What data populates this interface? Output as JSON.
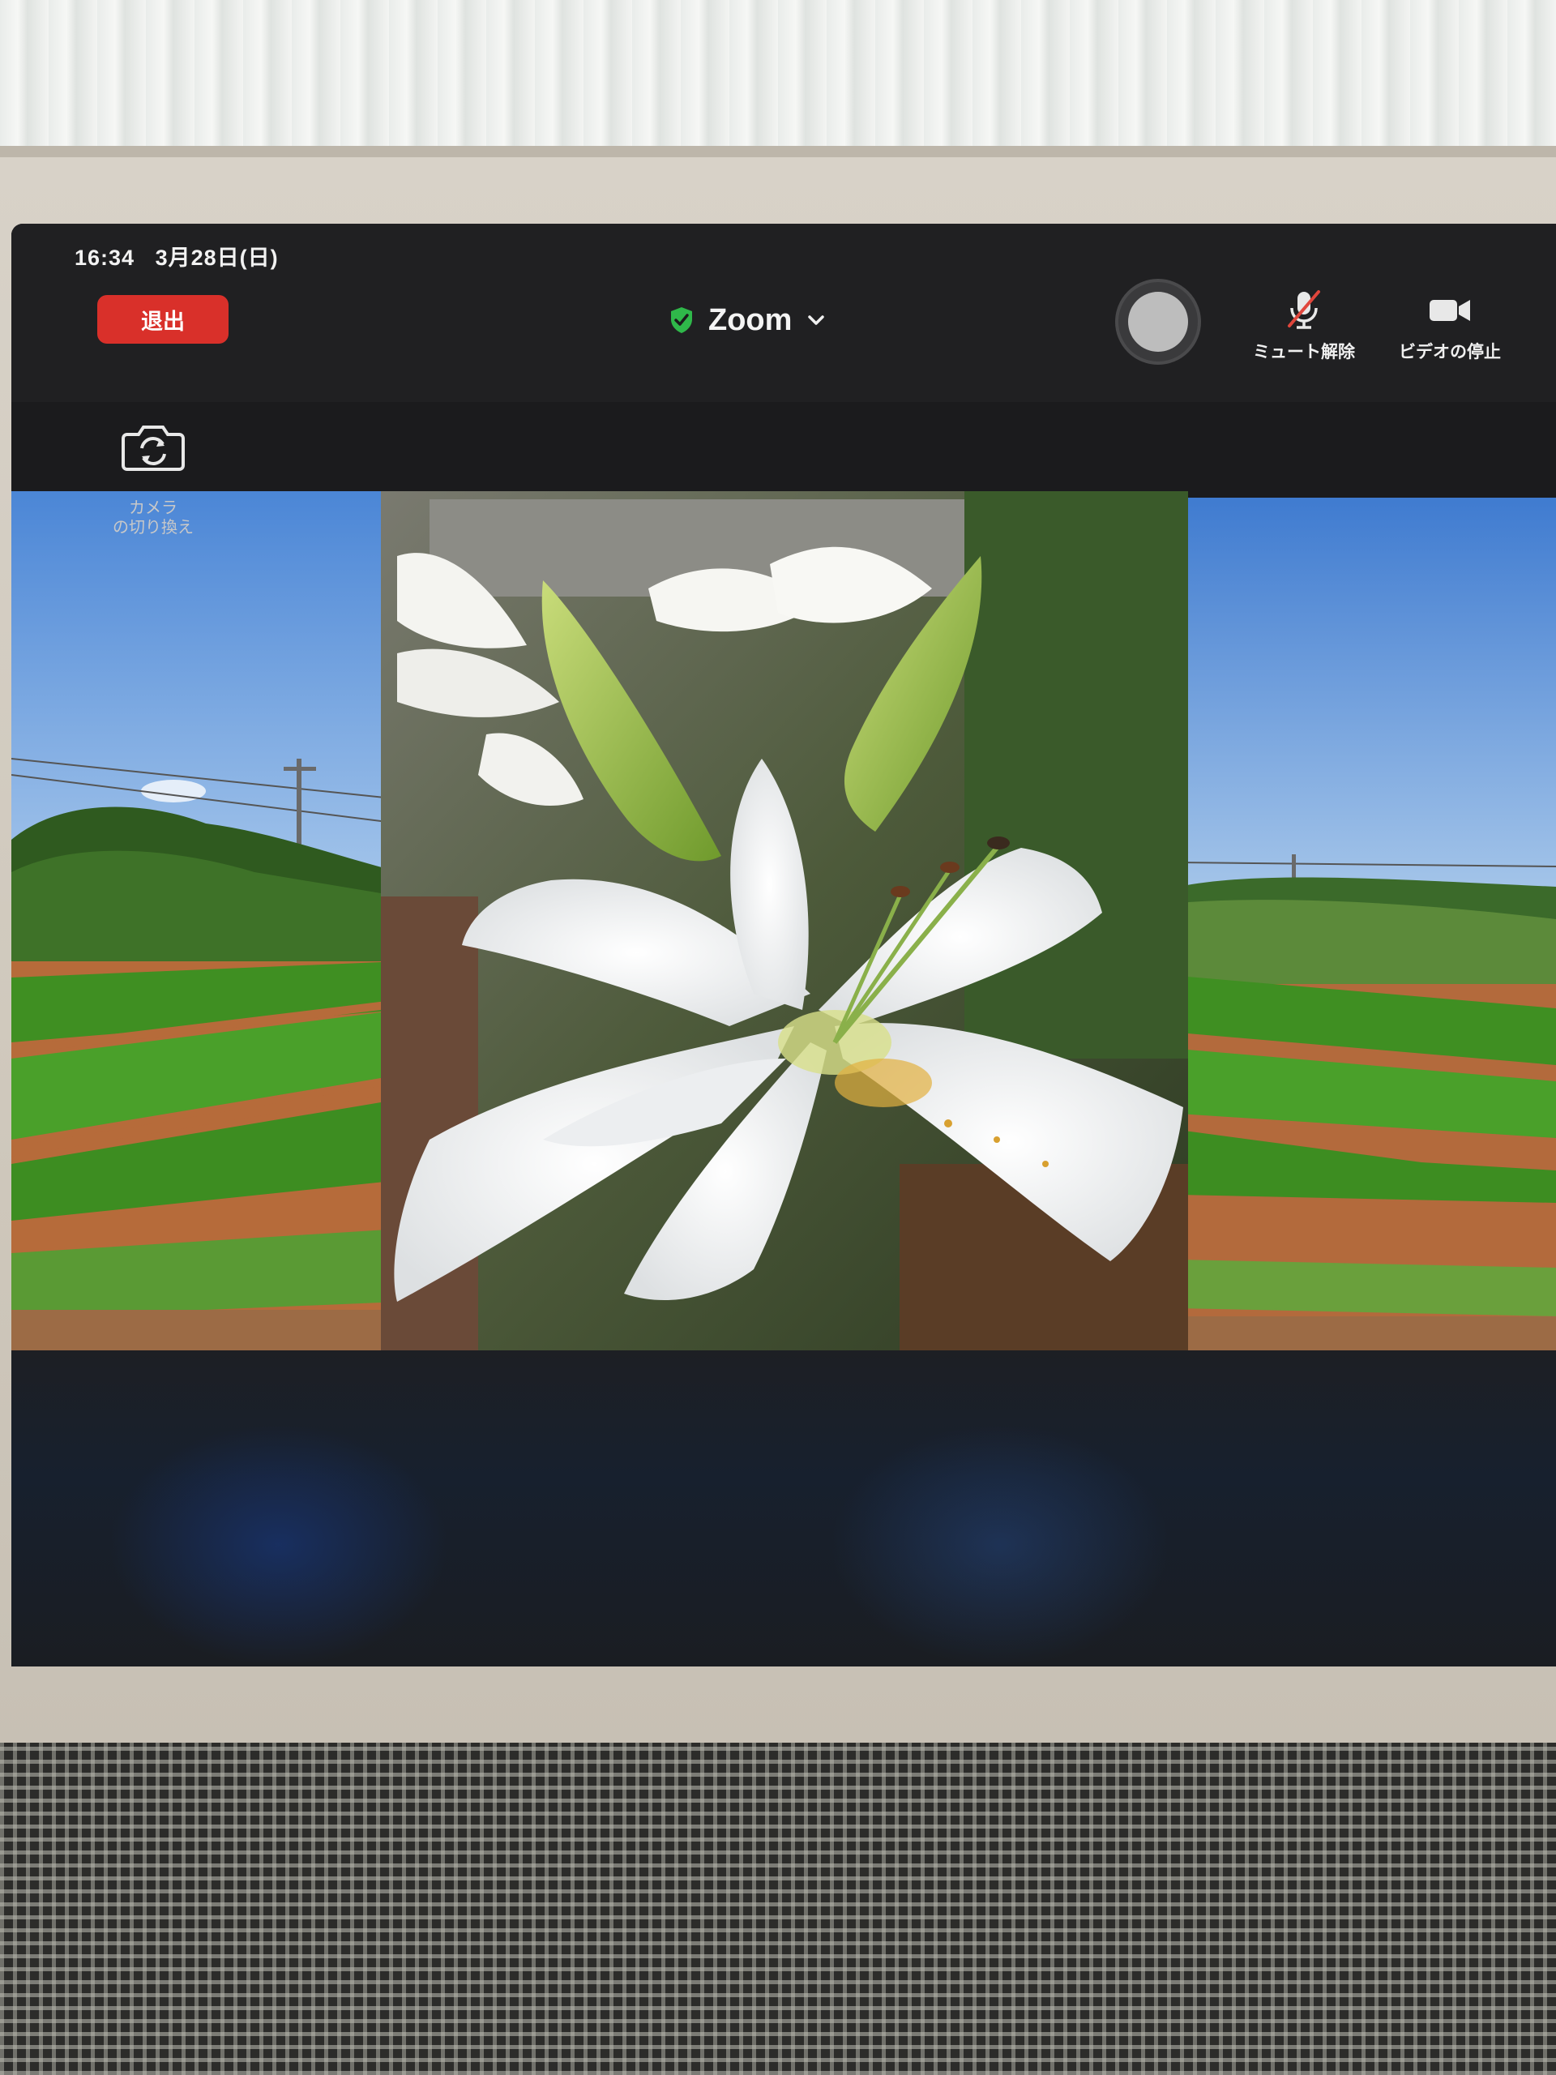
{
  "status_bar": {
    "time": "16:34",
    "date": "3月28日(日)"
  },
  "toolbar": {
    "leave_label": "退出",
    "meeting_name": "Zoom",
    "unmute_label": "ミュート解除",
    "stop_video_label": "ビデオの停止"
  },
  "camera": {
    "switch_label_line1": "カメラ",
    "switch_label_line2": "の切り換え"
  },
  "icons": {
    "shield": "shield-check-icon",
    "chevron": "chevron-down-icon",
    "mic": "mic-muted-icon",
    "video": "video-camera-icon",
    "camera_switch": "camera-switch-icon"
  },
  "colors": {
    "leave": "#d9302a",
    "shield": "#2fb84a",
    "mute_slash": "#e0463c"
  }
}
